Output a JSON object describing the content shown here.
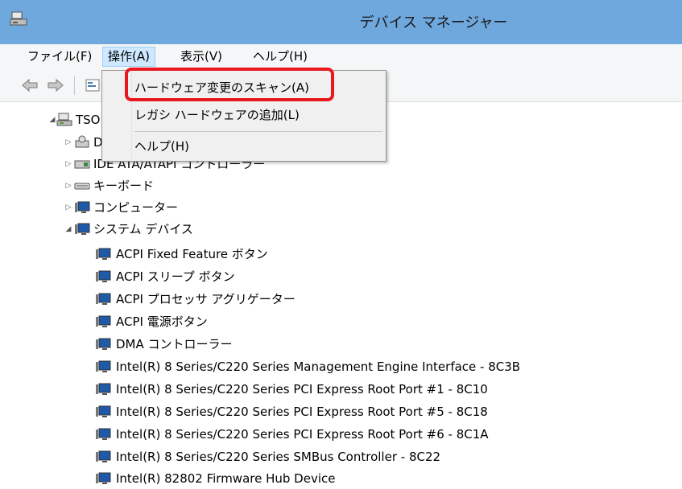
{
  "window": {
    "title": "デバイス マネージャー"
  },
  "menubar": {
    "items": [
      "ファイル(F)",
      "操作(A)",
      "表示(V)",
      "ヘルプ(H)"
    ]
  },
  "dropdown": {
    "items": [
      "ハードウェア変更のスキャン(A)",
      "レガシ ハードウェアの追加(L)",
      "ヘルプ(H)"
    ]
  },
  "tree": {
    "root": "TSO",
    "categories": [
      "D",
      "IDE ATA/ATAPI コントローラー",
      "キーボード",
      "コンピューター",
      "システム デバイス"
    ],
    "system_devices": [
      "ACPI Fixed Feature ボタン",
      "ACPI スリープ ボタン",
      "ACPI プロセッサ アグリゲーター",
      "ACPI 電源ボタン",
      "DMA コントローラー",
      "Intel(R) 8 Series/C220 Series Management Engine Interface - 8C3B",
      "Intel(R) 8 Series/C220 Series PCI Express Root Port #1 - 8C10",
      "Intel(R) 8 Series/C220 Series PCI Express Root Port #5 - 8C18",
      "Intel(R) 8 Series/C220 Series PCI Express Root Port #6 - 8C1A",
      "Intel(R) 8 Series/C220 Series SMBus Controller - 8C22",
      "Intel(R) 82802 Firmware Hub Device"
    ]
  },
  "colors": {
    "titlebar": "#6fa8dc",
    "highlight": "#e8181e",
    "menu_active": "#cde8ff"
  }
}
